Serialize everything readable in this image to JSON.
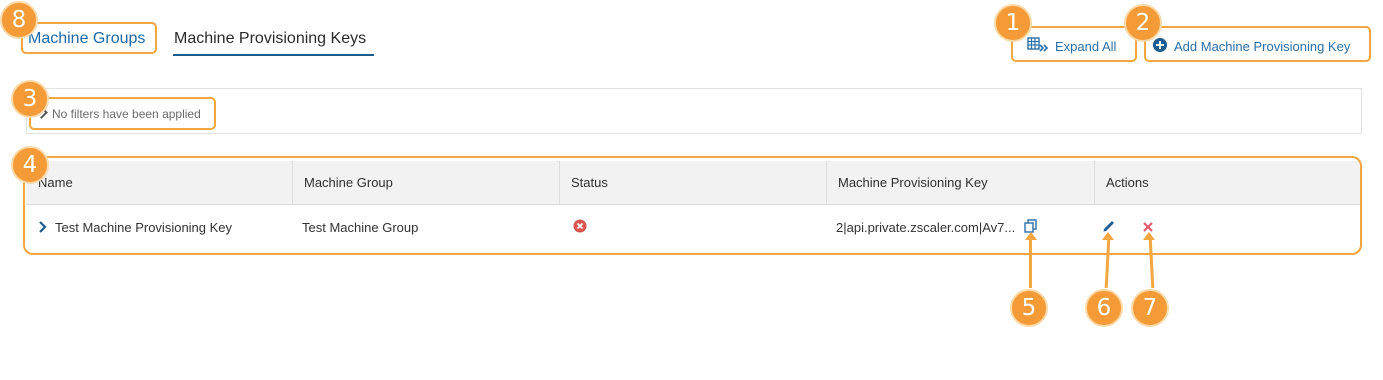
{
  "tabs": [
    {
      "label": "Machine Groups"
    },
    {
      "label": "Machine Provisioning Keys"
    }
  ],
  "toolbar": {
    "expand_label": "Expand All",
    "add_label": "Add Machine Provisioning Key"
  },
  "filter": {
    "text": "No filters have been applied"
  },
  "table": {
    "headers": [
      "Name",
      "Machine Group",
      "Status",
      "Machine Provisioning Key",
      "Actions"
    ],
    "rows": [
      {
        "name": "Test Machine Provisioning Key",
        "machine_group": "Test Machine Group",
        "status_icon": "disabled-x-circle-icon",
        "key": "2|api.private.zscaler.com|Av7..."
      }
    ]
  },
  "annotations": [
    "1",
    "2",
    "3",
    "4",
    "5",
    "6",
    "7",
    "8"
  ],
  "colors": {
    "accent": "#1e6aa8",
    "annotation": "#f49a36",
    "status_error": "#d9534f",
    "delete": "#e0566b"
  }
}
